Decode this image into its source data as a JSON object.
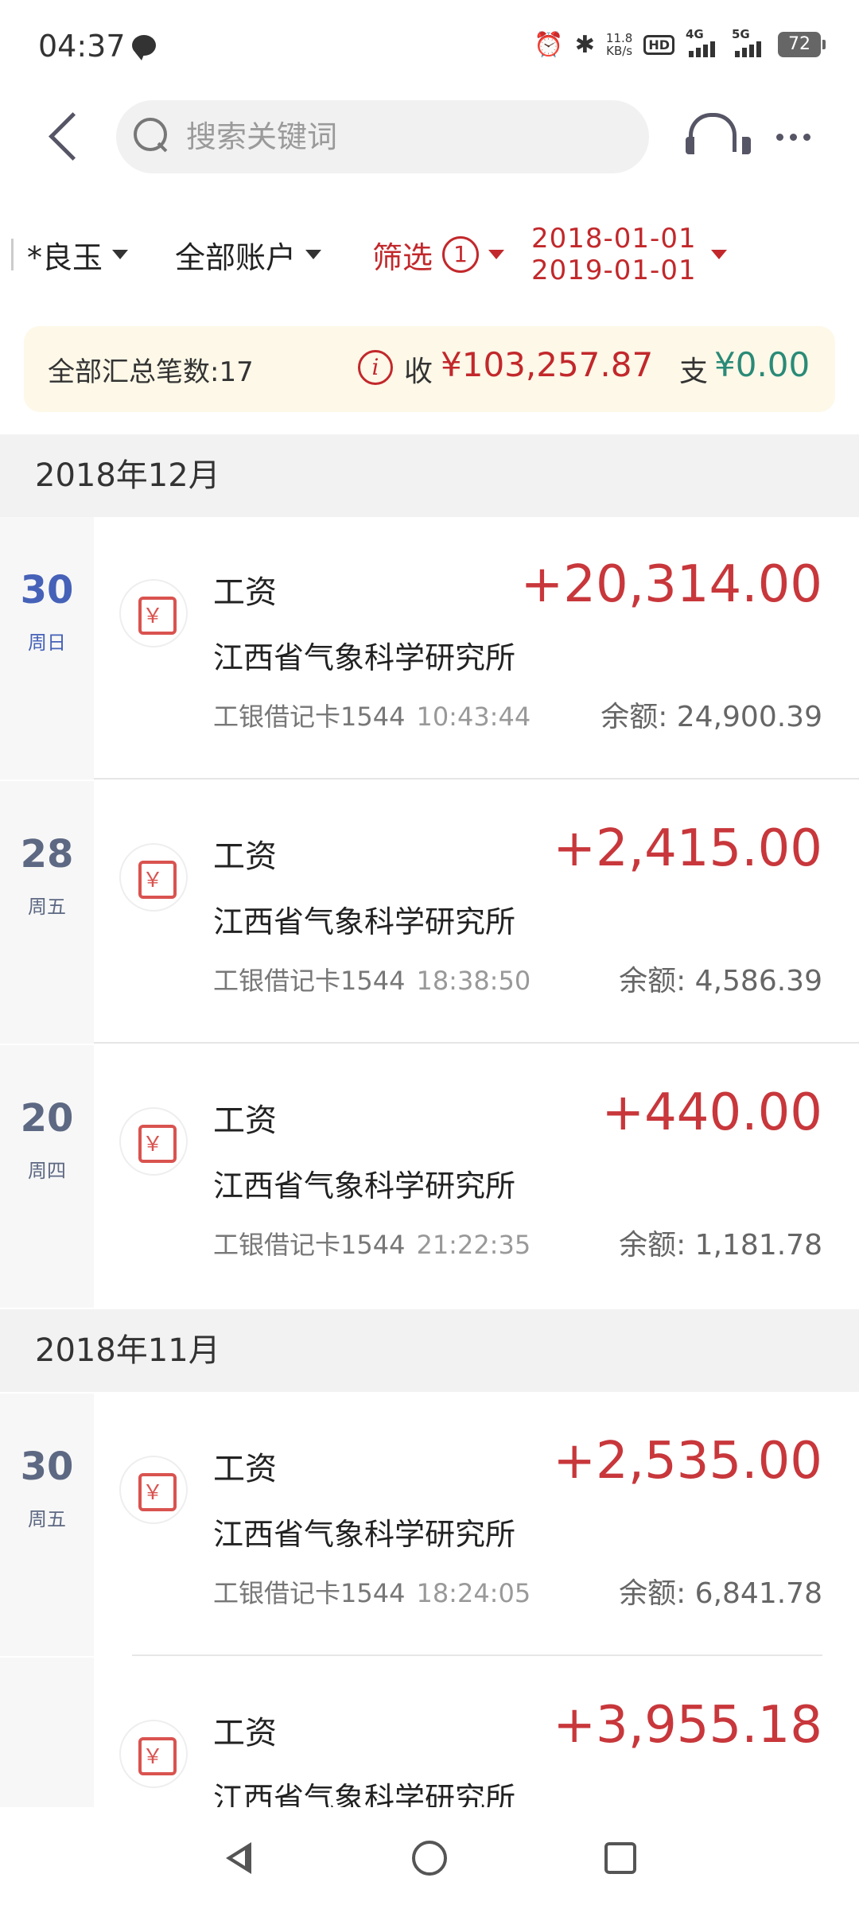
{
  "status_bar": {
    "time": "04:37",
    "net_speed_value": "11.8",
    "net_speed_unit": "KB/s",
    "hd_label": "HD",
    "net_label_1": "4G",
    "net_label_2": "5G",
    "battery": "72"
  },
  "header": {
    "search_placeholder": "搜索关键词",
    "icons": [
      "back-arrow-icon",
      "search-icon",
      "headset-icon",
      "more-icon"
    ]
  },
  "filters": {
    "member": "*良玉",
    "account": "全部账户",
    "filter_label": "筛选",
    "filter_count": "1",
    "date_start": "2018-01-01",
    "date_end": "2019-01-01"
  },
  "summary": {
    "count_text": "全部汇总笔数:17",
    "income_label": "收",
    "income_value": "¥103,257.87",
    "expense_label": "支",
    "expense_value": "¥0.00"
  },
  "colors": {
    "income_red": "#c8373b",
    "expense_green": "#2a8a77",
    "accent_red": "#c2282b",
    "summary_bg": "#fdf8e8"
  },
  "months": [
    {
      "label": "2018年12月",
      "transactions": [
        {
          "day": "30",
          "weekday": "周日",
          "category": "工资",
          "payer": "江西省气象科学研究所",
          "account": "工银借记卡1544",
          "time": "10:43:44",
          "amount": "+20,314.00",
          "balance": "余额: 24,900.39"
        },
        {
          "day": "28",
          "weekday": "周五",
          "category": "工资",
          "payer": "江西省气象科学研究所",
          "account": "工银借记卡1544",
          "time": "18:38:50",
          "amount": "+2,415.00",
          "balance": "余额: 4,586.39"
        },
        {
          "day": "20",
          "weekday": "周四",
          "category": "工资",
          "payer": "江西省气象科学研究所",
          "account": "工银借记卡1544",
          "time": "21:22:35",
          "amount": "+440.00",
          "balance": "余额: 1,181.78"
        }
      ]
    },
    {
      "label": "2018年11月",
      "transactions": [
        {
          "day": "30",
          "weekday": "周五",
          "category": "工资",
          "payer": "江西省气象科学研究所",
          "account": "工银借记卡1544",
          "time": "18:24:05",
          "amount": "+2,535.00",
          "balance": "余额: 6,841.78"
        },
        {
          "category": "工资",
          "payer": "江西省气象科学研究所",
          "amount": "+3,955.18"
        }
      ]
    }
  ]
}
